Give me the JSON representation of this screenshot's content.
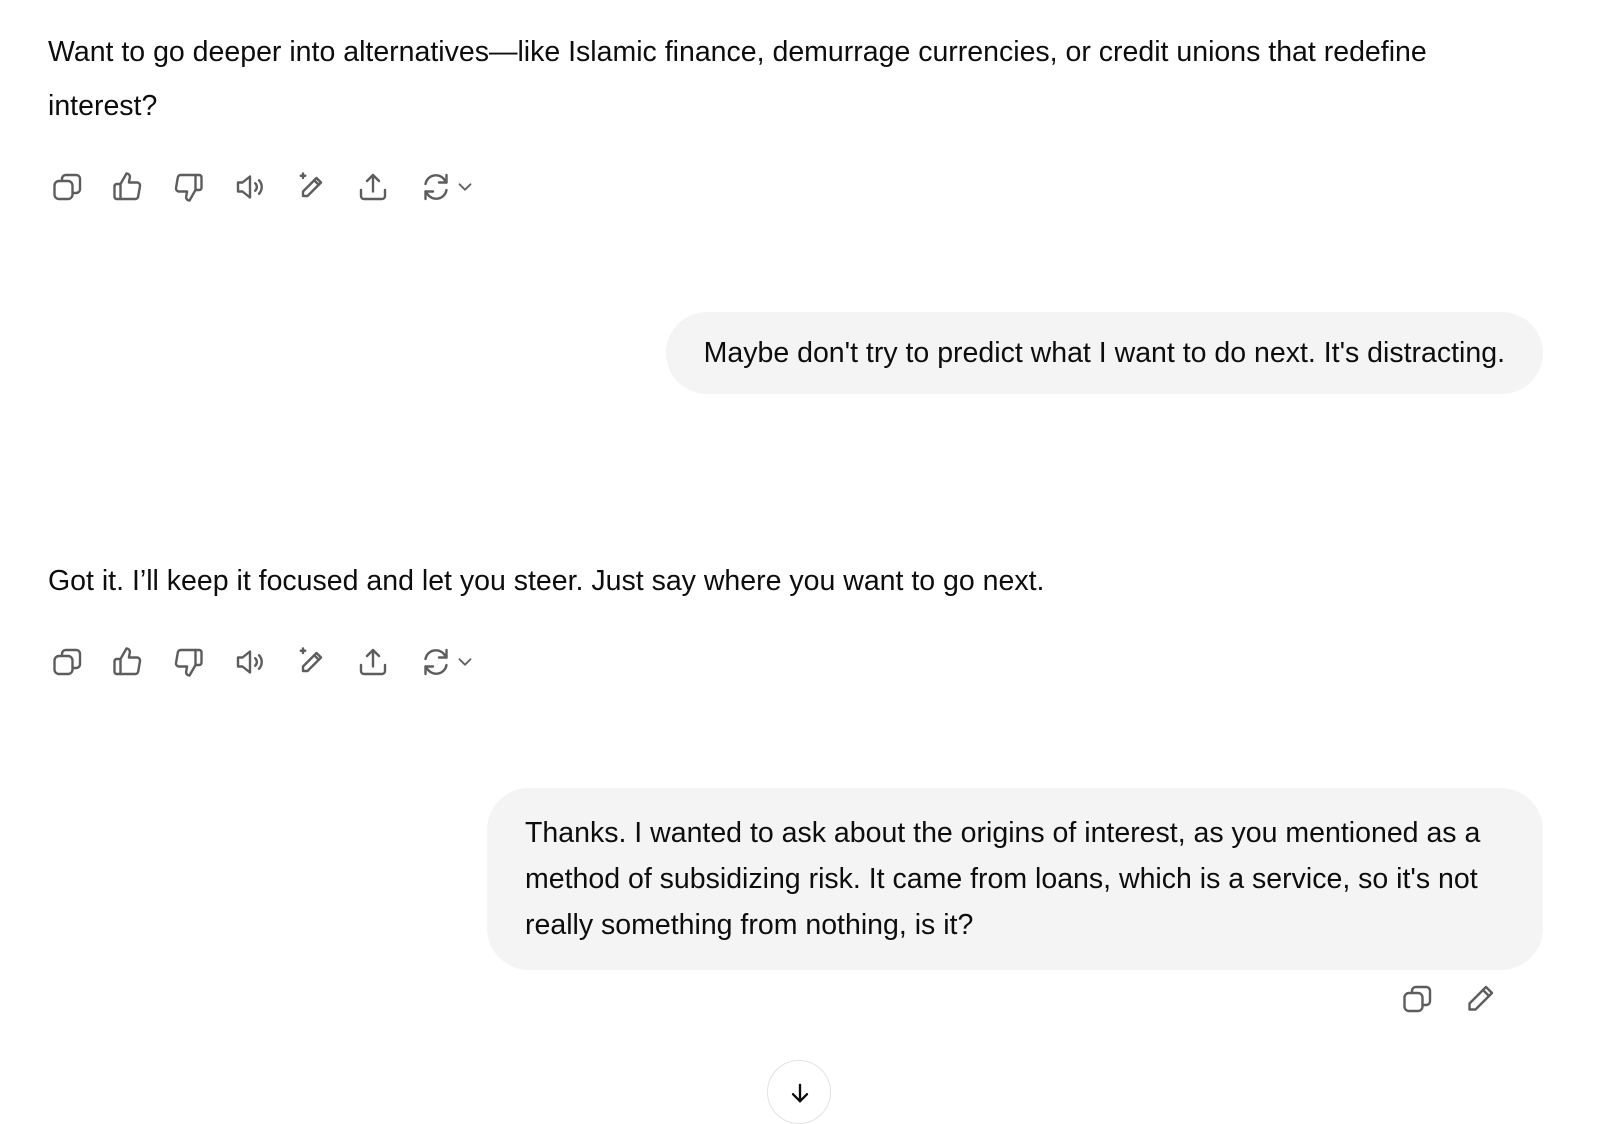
{
  "messages": {
    "assistant_1": "Want to go deeper into alternatives—like Islamic finance, demurrage currencies, or credit unions that redefine interest?",
    "user_1": "Maybe don't try to predict what I want to do next. It's distracting.",
    "assistant_2": "Got it. I’ll keep it focused and let you steer. Just say where you want to go next.",
    "user_2": "Thanks. I wanted to ask about the origins of interest, as you mentioned as a method of subsidizing risk. It came from loans, which is a service, so it's not really something from nothing, is it?"
  },
  "icons": {
    "assistant_actions": [
      "copy-icon",
      "thumbs-up-icon",
      "thumbs-down-icon",
      "read-aloud-icon",
      "edit-sparkle-icon",
      "share-icon",
      "regenerate-icon",
      "chevron-down-icon"
    ],
    "user_actions": [
      "copy-icon",
      "pencil-icon"
    ],
    "scroll": "scroll-down-icon"
  },
  "colors": {
    "bubble": "#f4f4f4",
    "text": "#0d0d0d",
    "icon": "#5d5d5d"
  }
}
